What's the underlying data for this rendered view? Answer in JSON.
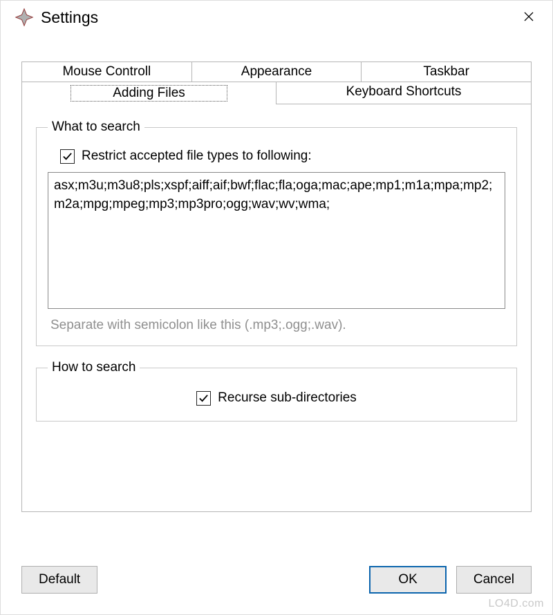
{
  "window": {
    "title": "Settings"
  },
  "tabs": {
    "row1": [
      "Mouse Controll",
      "Appearance",
      "Taskbar"
    ],
    "row2": [
      "Adding Files",
      "Keyboard Shortcuts"
    ],
    "active": "Adding Files"
  },
  "group_what": {
    "legend": "What to search",
    "checkbox_label": "Restrict accepted file types to following:",
    "checkbox_checked": true,
    "filetypes": "asx;m3u;m3u8;pls;xspf;aiff;aif;bwf;flac;fla;oga;mac;ape;mp1;m1a;mpa;mp2;m2a;mpg;mpeg;mp3;mp3pro;ogg;wav;wv;wma;",
    "hint": "Separate with semicolon like this (.mp3;.ogg;.wav)."
  },
  "group_how": {
    "legend": "How to search",
    "checkbox_label": "Recurse sub-directories",
    "checkbox_checked": true
  },
  "buttons": {
    "default": "Default",
    "ok": "OK",
    "cancel": "Cancel"
  },
  "watermark": "LO4D.com"
}
